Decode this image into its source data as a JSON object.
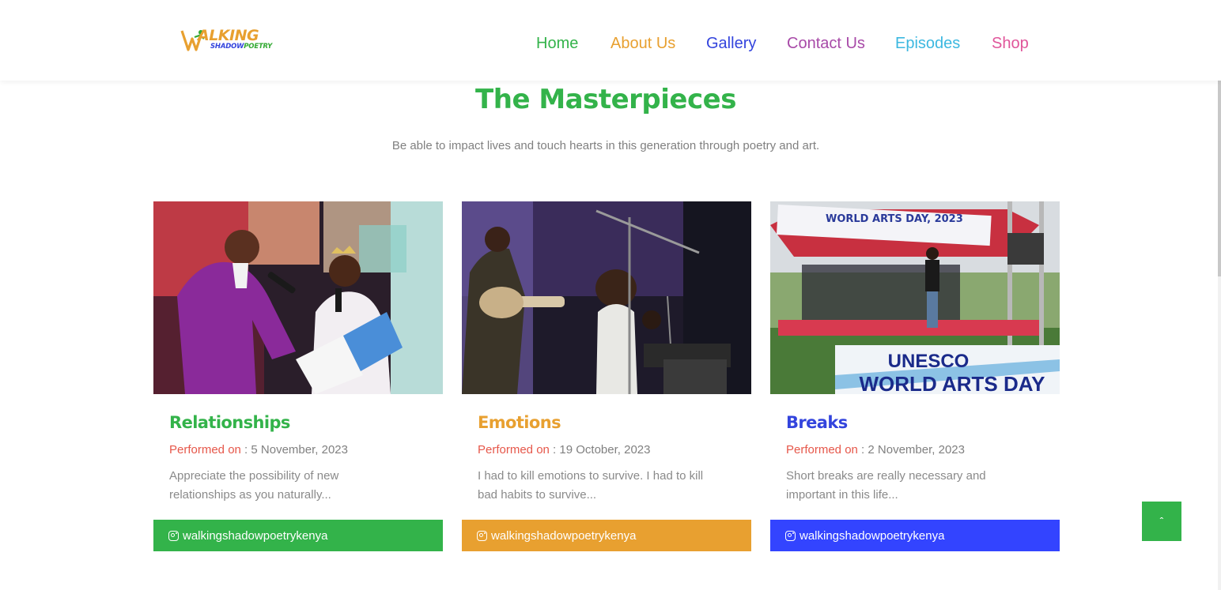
{
  "brand": {
    "logo_main": "ALKING",
    "logo_sub_a": "SHADOW",
    "logo_sub_b": "POETRY"
  },
  "nav": [
    {
      "label": "Home",
      "color": "#33b34a"
    },
    {
      "label": "About Us",
      "color": "#e8a030"
    },
    {
      "label": "Gallery",
      "color": "#3344dd"
    },
    {
      "label": "Contact Us",
      "color": "#a84aa8"
    },
    {
      "label": "Episodes",
      "color": "#3cb8e0"
    },
    {
      "label": "Shop",
      "color": "#e0559a"
    }
  ],
  "section": {
    "title": "The Masterpieces",
    "subtitle": "Be able to impact lives and touch hearts in this generation through poetry and art."
  },
  "cards": [
    {
      "title": "Relationships",
      "title_color": "#33b34a",
      "performed_label": "Performed on",
      "date": " : 5 November, 2023",
      "desc": "Appreciate the possibility of new relationships as you naturally...",
      "social": "walkingshadowpoetrykenya",
      "footer_color": "#33b34a"
    },
    {
      "title": "Emotions",
      "title_color": "#e8a030",
      "performed_label": "Performed on",
      "date": " : 19 October, 2023",
      "desc": "I had to kill emotions to survive. I had to kill bad habits to survive...",
      "social": "walkingshadowpoetrykenya",
      "footer_color": "#e8a030"
    },
    {
      "title": "Breaks",
      "title_color": "#3344dd",
      "performed_label": "Performed on",
      "date": " : 2 November, 2023",
      "desc": "Short breaks are really necessary and important in this life...",
      "social": "walkingshadowpoetrykenya",
      "footer_color": "#3344ff",
      "banner_top": "WORLD ARTS DAY, 2023",
      "banner_main_1": "UNESCO",
      "banner_main_2": "WORLD ARTS DAY"
    }
  ],
  "back_to_top": "ˆ"
}
